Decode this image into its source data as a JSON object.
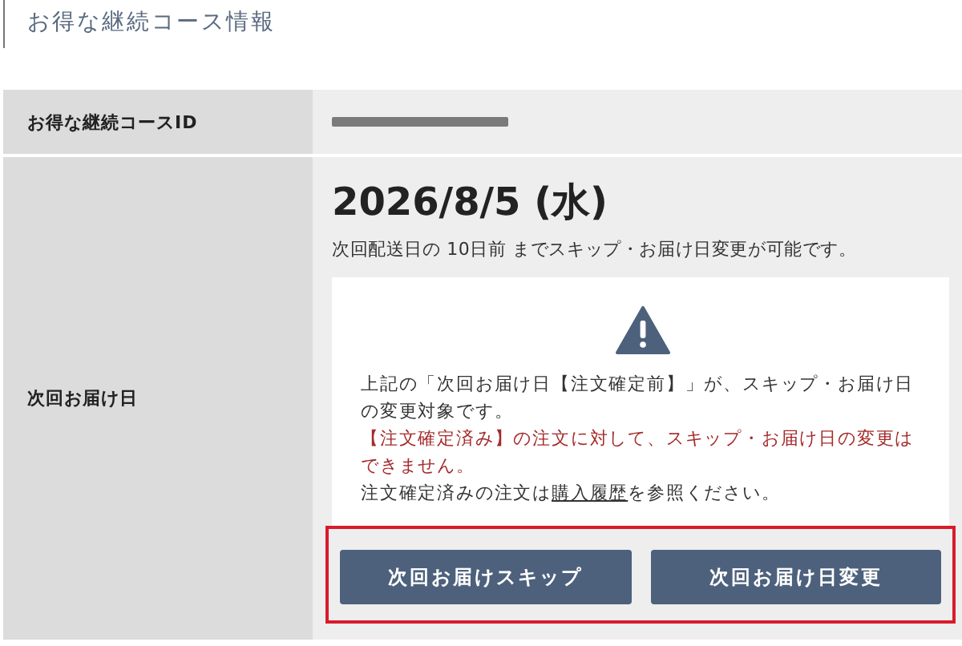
{
  "section_title": "お得な継続コース情報",
  "rows": [
    {
      "label": "お得な継続コースID",
      "kind": "redacted"
    },
    {
      "label": "次回お届け日",
      "kind": "delivery"
    }
  ],
  "delivery": {
    "date": "2026/8/5 (水)",
    "note": "次回配送日の 10日前 までスキップ・お届け日変更が可能です。",
    "notice": [
      {
        "kind": "plain",
        "text": "上記の「次回お届け日【注文確定前】」が、スキップ・お届け日の変更対象です。"
      },
      {
        "kind": "warning",
        "text": "【注文確定済み】の注文に対して、スキップ・お届け日の変更はできません。"
      },
      {
        "kind": "link",
        "before": "注文確定済みの注文は",
        "link": "購入履歴",
        "after": "を参照ください。"
      }
    ],
    "buttons": [
      "次回お届けスキップ",
      "次回お届け日変更"
    ],
    "buttons_highlighted": true
  }
}
